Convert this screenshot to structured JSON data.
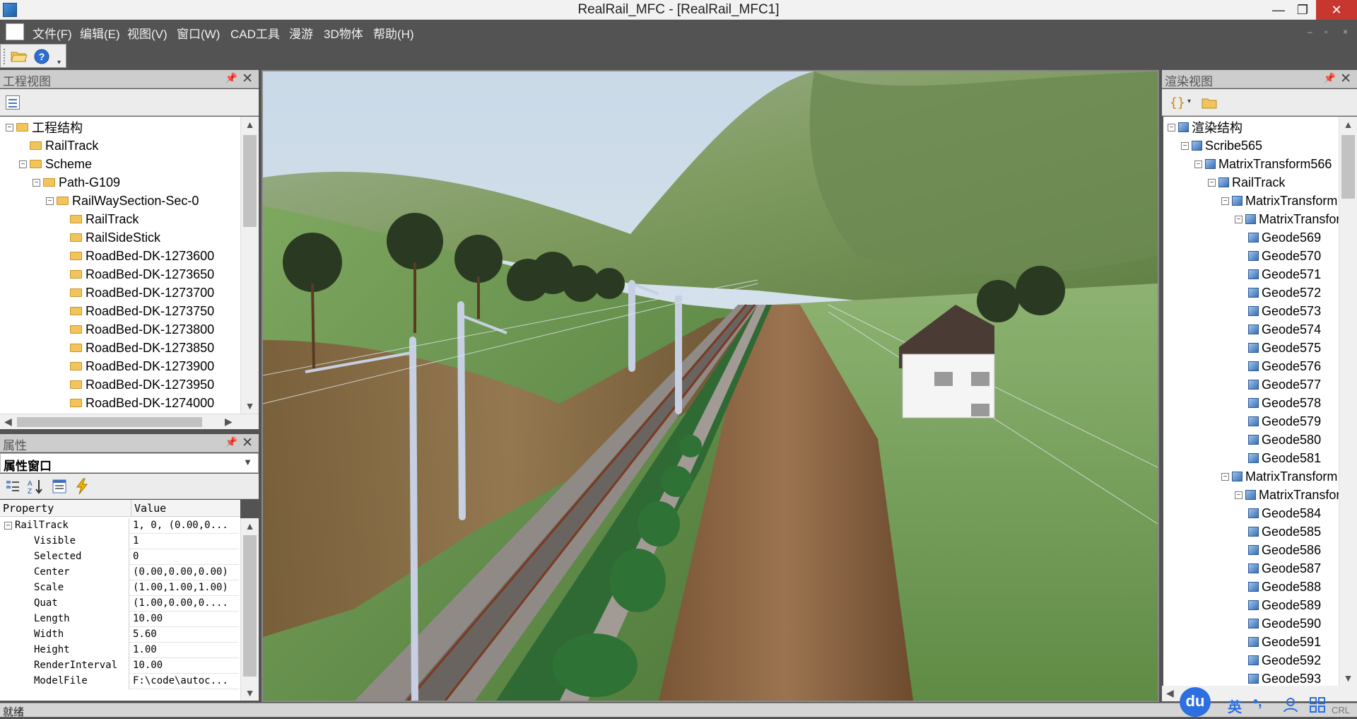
{
  "window": {
    "title": "RealRail_MFC - [RealRail_MFC1]",
    "minimize": "—",
    "restore": "❐",
    "close": "✕"
  },
  "menu": [
    "文件(F)",
    "编辑(E)",
    "视图(V)",
    "窗口(W)",
    "CAD工具",
    "漫游",
    "3D物体",
    "帮助(H)"
  ],
  "mdi_controls": [
    "–",
    "▫",
    "×"
  ],
  "project_view": {
    "title": "工程视图",
    "tree": [
      {
        "label": "工程结构",
        "level": 0,
        "expander": "−"
      },
      {
        "label": "RailTrack",
        "level": 1,
        "expander": ""
      },
      {
        "label": "Scheme",
        "level": 1,
        "expander": "−"
      },
      {
        "label": "Path-G109",
        "level": 2,
        "expander": "−"
      },
      {
        "label": "RailWaySection-Sec-0",
        "level": 3,
        "expander": "−"
      },
      {
        "label": "RailTrack",
        "level": 4,
        "expander": ""
      },
      {
        "label": "RailSideStick",
        "level": 4,
        "expander": ""
      },
      {
        "label": "RoadBed-DK-1273600",
        "level": 4,
        "expander": ""
      },
      {
        "label": "RoadBed-DK-1273650",
        "level": 4,
        "expander": ""
      },
      {
        "label": "RoadBed-DK-1273700",
        "level": 4,
        "expander": ""
      },
      {
        "label": "RoadBed-DK-1273750",
        "level": 4,
        "expander": ""
      },
      {
        "label": "RoadBed-DK-1273800",
        "level": 4,
        "expander": ""
      },
      {
        "label": "RoadBed-DK-1273850",
        "level": 4,
        "expander": ""
      },
      {
        "label": "RoadBed-DK-1273900",
        "level": 4,
        "expander": ""
      },
      {
        "label": "RoadBed-DK-1273950",
        "level": 4,
        "expander": ""
      },
      {
        "label": "RoadBed-DK-1274000",
        "level": 4,
        "expander": ""
      }
    ]
  },
  "properties": {
    "title": "属性",
    "combo": "属性窗口",
    "col_property": "Property",
    "col_value": "Value",
    "group": {
      "name": "RailTrack",
      "value": "1,  0,  (0.00,0..."
    },
    "rows": [
      {
        "key": "Visible",
        "value": "1"
      },
      {
        "key": "Selected",
        "value": "0"
      },
      {
        "key": "Center",
        "value": "(0.00,0.00,0.00)"
      },
      {
        "key": "Scale",
        "value": "(1.00,1.00,1.00)"
      },
      {
        "key": "Quat",
        "value": "(1.00,0.00,0...."
      },
      {
        "key": "Length",
        "value": "10.00"
      },
      {
        "key": "Width",
        "value": "5.60"
      },
      {
        "key": "Height",
        "value": "1.00"
      },
      {
        "key": "RenderInterval",
        "value": "10.00"
      },
      {
        "key": "ModelFile",
        "value": "F:\\code\\autoc..."
      }
    ]
  },
  "render_view": {
    "title": "渲染视图",
    "tree": [
      {
        "label": "渲染结构",
        "level": 0,
        "expander": "−"
      },
      {
        "label": "Scribe565",
        "level": 1,
        "expander": "−"
      },
      {
        "label": "MatrixTransform566",
        "level": 2,
        "expander": "−"
      },
      {
        "label": "RailTrack",
        "level": 3,
        "expander": "−"
      },
      {
        "label": "MatrixTransform",
        "level": 4,
        "expander": "−"
      },
      {
        "label": "MatrixTransform",
        "level": 5,
        "expander": "−"
      },
      {
        "label": "Geode569",
        "level": 6,
        "expander": ""
      },
      {
        "label": "Geode570",
        "level": 6,
        "expander": ""
      },
      {
        "label": "Geode571",
        "level": 6,
        "expander": ""
      },
      {
        "label": "Geode572",
        "level": 6,
        "expander": ""
      },
      {
        "label": "Geode573",
        "level": 6,
        "expander": ""
      },
      {
        "label": "Geode574",
        "level": 6,
        "expander": ""
      },
      {
        "label": "Geode575",
        "level": 6,
        "expander": ""
      },
      {
        "label": "Geode576",
        "level": 6,
        "expander": ""
      },
      {
        "label": "Geode577",
        "level": 6,
        "expander": ""
      },
      {
        "label": "Geode578",
        "level": 6,
        "expander": ""
      },
      {
        "label": "Geode579",
        "level": 6,
        "expander": ""
      },
      {
        "label": "Geode580",
        "level": 6,
        "expander": ""
      },
      {
        "label": "Geode581",
        "level": 6,
        "expander": ""
      },
      {
        "label": "MatrixTransform",
        "level": 4,
        "expander": "−"
      },
      {
        "label": "MatrixTransform",
        "level": 5,
        "expander": "−"
      },
      {
        "label": "Geode584",
        "level": 6,
        "expander": ""
      },
      {
        "label": "Geode585",
        "level": 6,
        "expander": ""
      },
      {
        "label": "Geode586",
        "level": 6,
        "expander": ""
      },
      {
        "label": "Geode587",
        "level": 6,
        "expander": ""
      },
      {
        "label": "Geode588",
        "level": 6,
        "expander": ""
      },
      {
        "label": "Geode589",
        "level": 6,
        "expander": ""
      },
      {
        "label": "Geode590",
        "level": 6,
        "expander": ""
      },
      {
        "label": "Geode591",
        "level": 6,
        "expander": ""
      },
      {
        "label": "Geode592",
        "level": 6,
        "expander": ""
      },
      {
        "label": "Geode593",
        "level": 6,
        "expander": ""
      }
    ]
  },
  "statusbar": {
    "text": "就绪",
    "right": "CRL"
  },
  "ime": {
    "logo": "du",
    "lang": "英",
    "punct": "•,"
  }
}
